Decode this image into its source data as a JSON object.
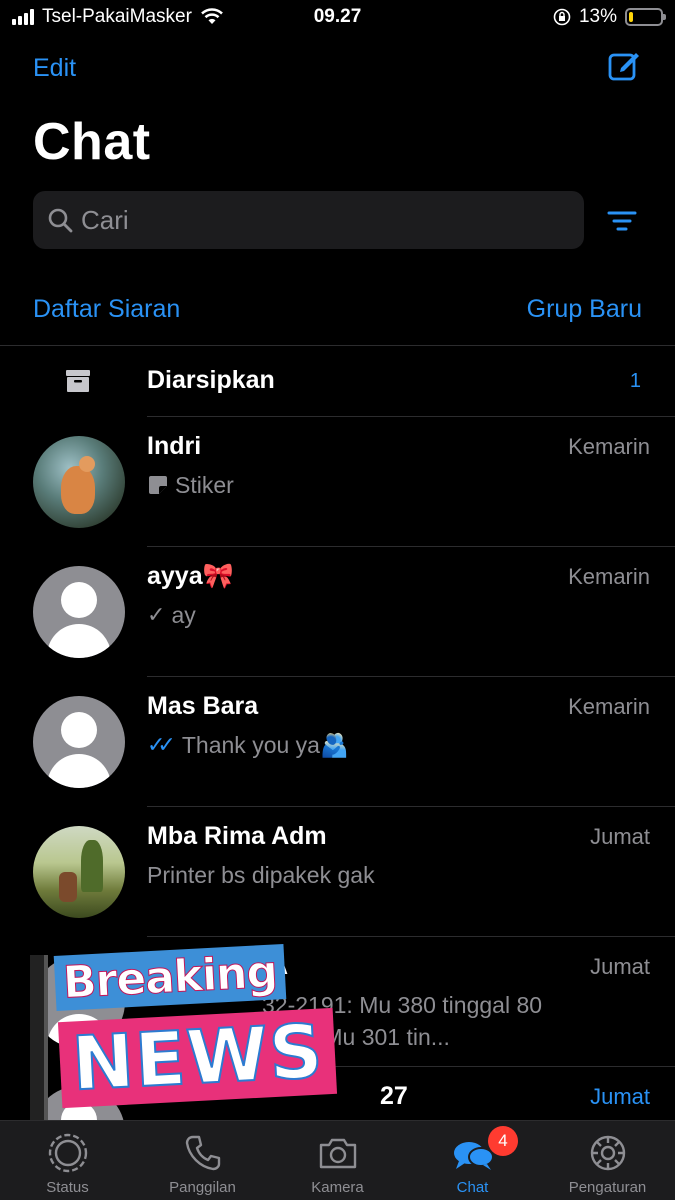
{
  "status_bar": {
    "carrier": "Tsel-PakaiMasker",
    "time": "09.27",
    "battery_text": "13%",
    "battery_level": 0.13
  },
  "header": {
    "edit_label": "Edit",
    "title": "Chat",
    "search_placeholder": "Cari"
  },
  "links": {
    "broadcast": "Daftar Siaran",
    "new_group": "Grup Baru"
  },
  "archived": {
    "label": "Diarsipkan",
    "count": "1"
  },
  "chats": [
    {
      "name": "Indri",
      "time": "Kemarin",
      "preview": "Stiker",
      "preview_icon": "sticker-icon",
      "avatar": "photo-duck"
    },
    {
      "name": "ayya🎀",
      "time": "Kemarin",
      "preview": "ay",
      "preview_icon": "single-check-icon",
      "avatar": "default"
    },
    {
      "name": "Mas Bara",
      "time": "Kemarin",
      "preview": "Thank you ya🫂",
      "preview_icon": "double-check-blue-icon",
      "avatar": "default"
    },
    {
      "name": "Mba Rima Adm",
      "time": "Jumat",
      "preview": "Printer bs dipakek gak",
      "avatar": "photo-outdoor"
    },
    {
      "name": "A",
      "time": "Jumat",
      "preview": "32-2191: Mu 380 tinggal 80\n0 sak Mu 301 tin...",
      "avatar": "default"
    },
    {
      "name": "27",
      "time": "Jumat",
      "preview": "",
      "avatar": "default",
      "time_color": "#2a92f5"
    }
  ],
  "overlay": {
    "line1": "Breaking",
    "line2": "NEWS"
  },
  "tabs": [
    {
      "label": "Status",
      "icon": "status-icon"
    },
    {
      "label": "Panggilan",
      "icon": "phone-icon"
    },
    {
      "label": "Kamera",
      "icon": "camera-icon"
    },
    {
      "label": "Chat",
      "icon": "chat-bubbles-icon",
      "active": true,
      "badge": "4"
    },
    {
      "label": "Pengaturan",
      "icon": "gear-icon"
    }
  ],
  "colors": {
    "accent": "#2a92f5",
    "background": "#000000",
    "secondary_text": "#8e8e93",
    "badge": "#ff3b30"
  }
}
